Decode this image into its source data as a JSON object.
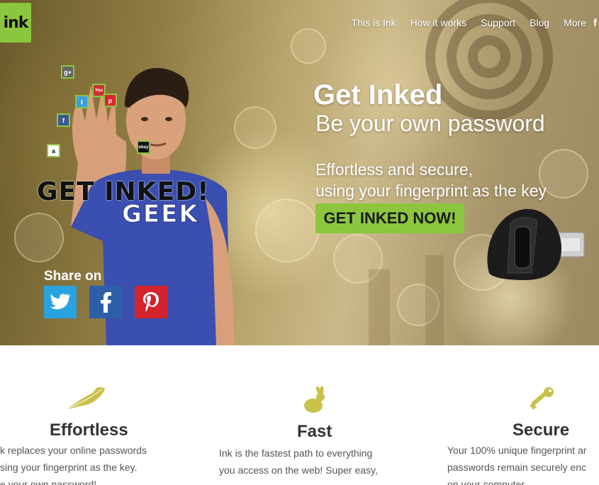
{
  "brand": {
    "logo_text": "ink",
    "accent": "#8cc63f"
  },
  "nav": {
    "items": [
      {
        "label": "This is Ink"
      },
      {
        "label": "How it works"
      },
      {
        "label": "Support"
      },
      {
        "label": "Blog"
      },
      {
        "label": "More"
      }
    ],
    "facebook_glyph": "f"
  },
  "hero": {
    "headline": "Get Inked",
    "subline": "Be your own password",
    "tagline_1": "Effortless and secure,",
    "tagline_2": "using your fingerprint as the key",
    "cta_label": "GET INKED NOW!",
    "image_text": "GET INKED!",
    "shirt_text": "GEEK",
    "app_icons": {
      "google_plus": "g+",
      "youtube": "You",
      "pinterest": "p",
      "twitter": "t",
      "facebook": "f",
      "amazon": "a",
      "ebay": "ebay"
    },
    "share_label": "Share on"
  },
  "features": [
    {
      "title": "Effortless",
      "line_1": "k replaces your online passwords",
      "line_2": "sing your fingerprint as the key.",
      "line_3": "e your own password!",
      "icon": "feather-icon"
    },
    {
      "title": "Fast",
      "line_1": "Ink is the fastest path to everything",
      "line_2": "you access on the web! Super easy,",
      "icon": "rabbit-icon"
    },
    {
      "title": "Secure",
      "line_1": "Your 100% unique fingerprint ar",
      "line_2": "passwords remain securely enc",
      "line_3": "on your computer",
      "icon": "key-icon"
    }
  ]
}
